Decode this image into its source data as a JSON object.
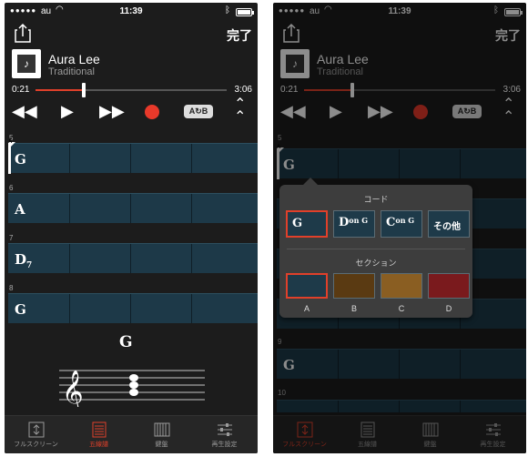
{
  "status": {
    "carrier": "au",
    "time": "11:39"
  },
  "header": {
    "done_label": "完了",
    "song_title": "Aura Lee",
    "song_artist": "Traditional"
  },
  "player": {
    "current_time": "0:21",
    "total_time": "3:06",
    "progress_fraction": 0.25,
    "ab_label": "A↻B"
  },
  "colors": {
    "accent": "#e0402a",
    "measure_bg": "#1d3948"
  },
  "phone1": {
    "measures": [
      {
        "number": "5",
        "chord": "G",
        "sub": ""
      },
      {
        "number": "6",
        "chord": "A",
        "sub": ""
      },
      {
        "number": "7",
        "chord": "D",
        "sub": "7"
      },
      {
        "number": "8",
        "chord": "G",
        "sub": ""
      }
    ],
    "current_chord": "G"
  },
  "phone2": {
    "measures": [
      {
        "number": "5",
        "chord": "G"
      },
      {
        "number": "9",
        "chord": "G"
      },
      {
        "number": "10",
        "chord": ""
      }
    ],
    "popup": {
      "chord_header": "コード",
      "chord_options": [
        {
          "root": "G",
          "on": ""
        },
        {
          "root": "D",
          "on": "on G"
        },
        {
          "root": "C",
          "on": "on G"
        }
      ],
      "other_label": "その他",
      "section_header": "セクション",
      "sections": [
        {
          "label": "A",
          "color": "#1e3a49"
        },
        {
          "label": "B",
          "color": "#5a3a12"
        },
        {
          "label": "C",
          "color": "#8a5e22"
        },
        {
          "label": "D",
          "color": "#7a1a1d"
        }
      ]
    }
  },
  "tabs": [
    {
      "label": "フルスクリーン",
      "icon": "fullscreen-icon"
    },
    {
      "label": "五線譜",
      "icon": "score-icon"
    },
    {
      "label": "鍵盤",
      "icon": "keyboard-icon"
    },
    {
      "label": "再生設定",
      "icon": "settings-sliders-icon"
    }
  ],
  "tab_active": {
    "phone1": "五線譜",
    "phone2": "フルスクリーン"
  }
}
